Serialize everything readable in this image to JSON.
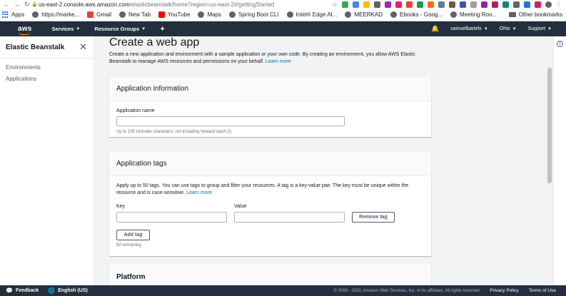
{
  "browser": {
    "url_host": "us-east-2.console.aws.amazon.com",
    "url_path": "/elasticbeanstalk/home?region=us-east-2#/gettingStarted",
    "bookmarks": [
      {
        "label": "Apps",
        "icon": "apps-grid-icon",
        "color": "#1a73e8"
      },
      {
        "label": "https://marke...",
        "icon": "globe-icon",
        "color": "#5f6368"
      },
      {
        "label": "Gmail",
        "icon": "gmail-icon",
        "color": "#ea4335"
      },
      {
        "label": "New Tab",
        "icon": "globe-icon",
        "color": "#5f6368"
      },
      {
        "label": "YouTube",
        "icon": "youtube-icon",
        "color": "#ff0000"
      },
      {
        "label": "Maps",
        "icon": "globe-icon",
        "color": "#5f6368"
      },
      {
        "label": "Spring Boot CLI",
        "icon": "globe-icon",
        "color": "#5f6368"
      },
      {
        "label": "Intel® Edge AI...",
        "icon": "globe-icon",
        "color": "#5f6368"
      },
      {
        "label": "MEERKAD",
        "icon": "globe-icon",
        "color": "#5f6368"
      },
      {
        "label": "Ebooks - Goog...",
        "icon": "globe-icon",
        "color": "#5f6368"
      },
      {
        "label": "Meeting Roo...",
        "icon": "globe-icon",
        "color": "#5f6368"
      }
    ],
    "other_bookmarks": "Other bookmarks"
  },
  "aws_nav": {
    "logo": "aws",
    "services": "Services",
    "resource_groups": "Resource Groups",
    "user": "samuelbartels",
    "region": "Ohio",
    "support": "Support"
  },
  "sidebar": {
    "title": "Elastic Beanstalk",
    "items": [
      {
        "label": "Environments"
      },
      {
        "label": "Applications"
      }
    ]
  },
  "main": {
    "title": "Create a web app",
    "description": "Create a new application and environment with a sample application or your own code. By creating an environment, you allow AWS Elastic Beanstalk to manage AWS resources and permissions on your behalf.",
    "learn_more": "Learn more",
    "app_info": {
      "header": "Application information",
      "name_label": "Application name",
      "name_value": "",
      "name_hint": "Up to 100 Unicode characters, not including forward slash (/)."
    },
    "app_tags": {
      "header": "Application tags",
      "description": "Apply up to 50 tags. You can use tags to group and filter your resources. A tag is a key-value pair. The key must be unique within the resource and is case-sensitive.",
      "learn_more": "Learn more",
      "key_label": "Key",
      "value_label": "Value",
      "key_value": "",
      "value_value": "",
      "remove_tag": "Remove tag",
      "add_tag": "Add tag",
      "remaining": "50 remaining"
    },
    "platform": {
      "header": "Platform"
    }
  },
  "footer": {
    "feedback": "Feedback",
    "language": "English (US)",
    "copyright": "© 2008 - 2020, Amazon Web Services, Inc. or its affiliates. All rights reserved.",
    "privacy": "Privacy Policy",
    "terms": "Terms of Use"
  }
}
